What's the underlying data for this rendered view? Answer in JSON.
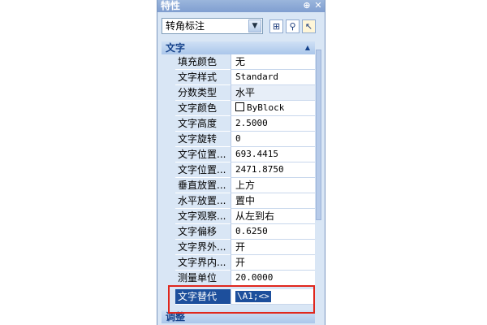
{
  "panel": {
    "title": "特性",
    "pin_glyph": "⊕",
    "close_glyph": "✕"
  },
  "toolbar": {
    "object_type": "转角标注",
    "tools": [
      {
        "icon": "select-toggle-icon",
        "glyph": "⊞"
      },
      {
        "icon": "quick-select-icon",
        "glyph": "⚲"
      },
      {
        "icon": "select-objects-icon",
        "glyph": "↖"
      }
    ]
  },
  "sections": {
    "text": {
      "label": "文字",
      "chevron": "▲"
    },
    "adjust": {
      "label": "调整"
    }
  },
  "properties": [
    {
      "name": "填充颜色",
      "value": "无"
    },
    {
      "name": "文字样式",
      "value": "Standard"
    },
    {
      "name": "分数类型",
      "value": "水平"
    },
    {
      "name": "文字颜色",
      "value": "ByBlock"
    },
    {
      "name": "文字高度",
      "value": "2.5000"
    },
    {
      "name": "文字旋转",
      "value": "0"
    },
    {
      "name": "文字位置...",
      "value": "693.4415"
    },
    {
      "name": "文字位置...",
      "value": "2471.8750"
    },
    {
      "name": "垂直放置...",
      "value": "上方"
    },
    {
      "name": "水平放置...",
      "value": "置中"
    },
    {
      "name": "文字观察...",
      "value": "从左到右"
    },
    {
      "name": "文字偏移",
      "value": "0.6250"
    },
    {
      "name": "文字界外...",
      "value": "开"
    },
    {
      "name": "文字界内...",
      "value": "开"
    },
    {
      "name": "测量单位",
      "value": "20.0000"
    },
    {
      "name": "文字替代",
      "value": "\\A1;<>"
    }
  ],
  "colors": {
    "panel_bg": "#d9e6f5",
    "selection": "#1d4f9c",
    "highlight_box": "#e0271d"
  }
}
